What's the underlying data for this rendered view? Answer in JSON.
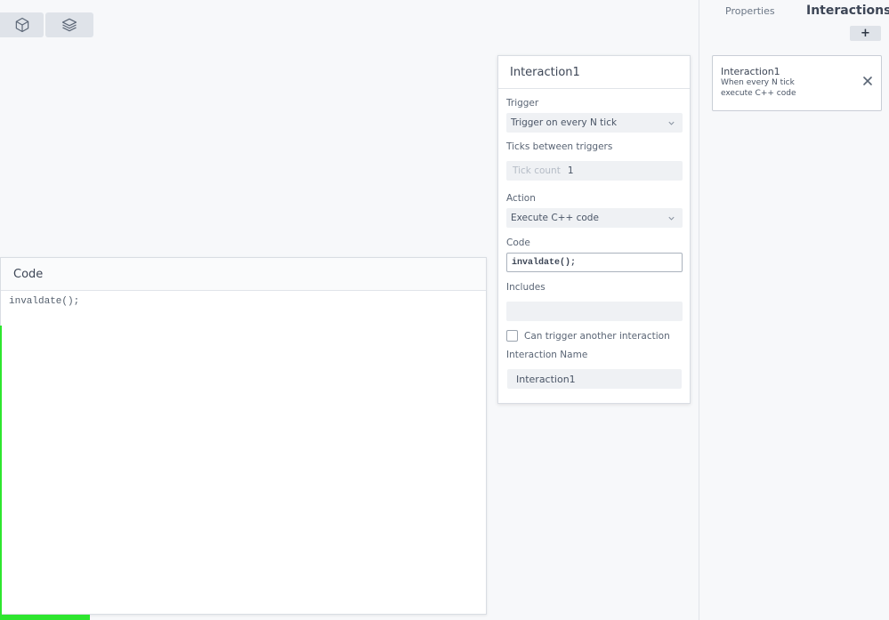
{
  "toolbar": {
    "buttons": [
      {
        "icon": "cube-icon"
      },
      {
        "icon": "layers-icon"
      }
    ]
  },
  "code_panel": {
    "title": "Code",
    "content": "invaldate();"
  },
  "interaction_editor": {
    "title": "Interaction1",
    "trigger_label": "Trigger",
    "trigger_value": "Trigger on every N tick",
    "ticks_label": "Ticks between triggers",
    "tick_count_placeholder": "Tick count",
    "tick_count_value": "1",
    "action_label": "Action",
    "action_value": "Execute C++ code",
    "code_label": "Code",
    "code_value": "invaldate();",
    "includes_label": "Includes",
    "includes_value": "",
    "can_trigger_label": "Can trigger another interaction",
    "can_trigger_checked": false,
    "name_label": "Interaction Name",
    "name_value": "Interaction1"
  },
  "sidebar": {
    "tabs": {
      "properties": "Properties",
      "interactions": "Interactions"
    },
    "add_label": "+",
    "interactions": [
      {
        "title": "Interaction1",
        "line1": "When every N tick",
        "line2": "execute C++ code"
      }
    ]
  },
  "colors": {
    "accent_green": "#2ee62e",
    "panel_bg": "#ffffff",
    "field_bg": "#eff1f4"
  }
}
